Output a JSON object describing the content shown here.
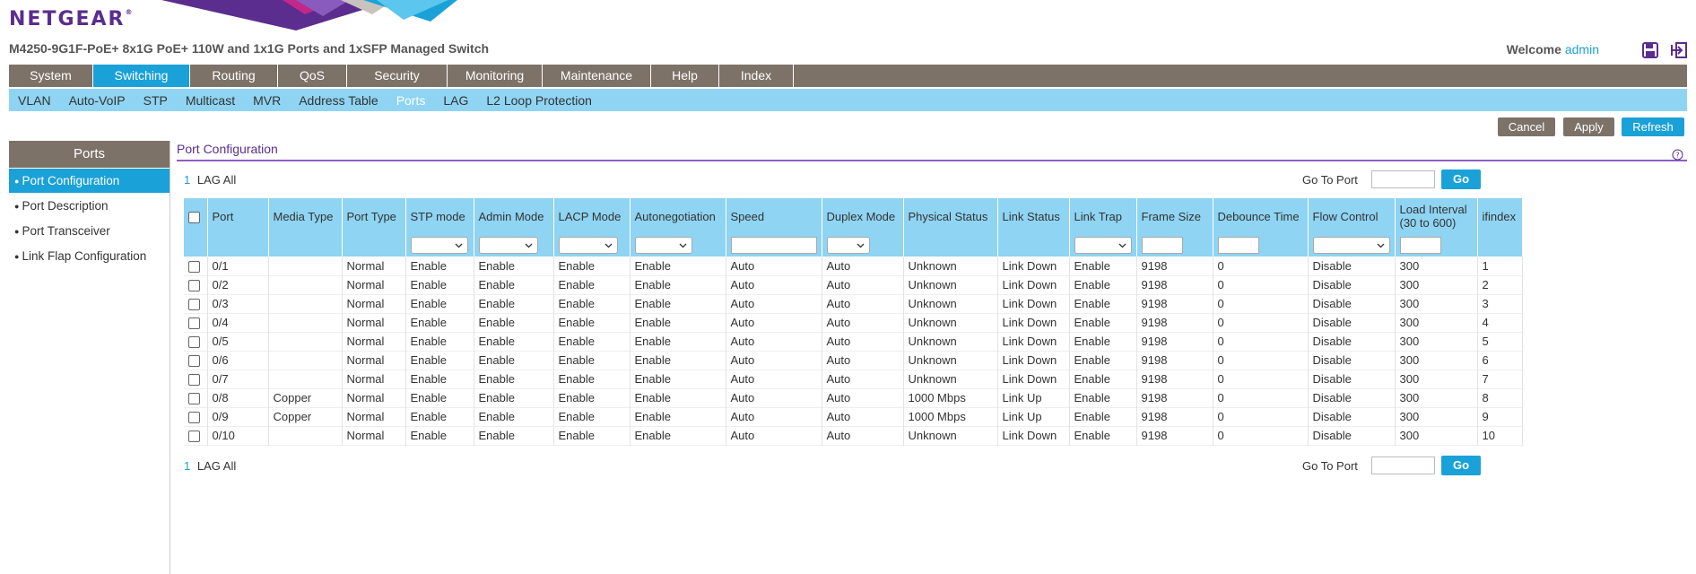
{
  "brand": {
    "logo": "NETGEAR",
    "mark": "®"
  },
  "device_title": "M4250-9G1F-PoE+ 8x1G PoE+ 110W and 1x1G Ports and 1xSFP Managed Switch",
  "welcome": {
    "label": "Welcome",
    "user": "admin"
  },
  "main_nav": [
    {
      "label": "System"
    },
    {
      "label": "Switching"
    },
    {
      "label": "Routing"
    },
    {
      "label": "QoS"
    },
    {
      "label": "Security"
    },
    {
      "label": "Monitoring"
    },
    {
      "label": "Maintenance"
    },
    {
      "label": "Help"
    },
    {
      "label": "Index"
    }
  ],
  "main_nav_active": "Switching",
  "sub_nav": [
    {
      "label": "VLAN"
    },
    {
      "label": "Auto-VoIP"
    },
    {
      "label": "STP"
    },
    {
      "label": "Multicast"
    },
    {
      "label": "MVR"
    },
    {
      "label": "Address Table"
    },
    {
      "label": "Ports"
    },
    {
      "label": "LAG"
    },
    {
      "label": "L2 Loop Protection"
    }
  ],
  "sub_nav_active": "Ports",
  "actions": {
    "cancel": "Cancel",
    "apply": "Apply",
    "refresh": "Refresh"
  },
  "sidebar": {
    "title": "Ports",
    "items": [
      {
        "label": "Port Configuration"
      },
      {
        "label": "Port Description"
      },
      {
        "label": "Port Transceiver"
      },
      {
        "label": "Link Flap Configuration"
      }
    ]
  },
  "section": {
    "title": "Port Configuration"
  },
  "pager": {
    "page": "1",
    "lag": "LAG",
    "all": "All",
    "goto_label": "Go To Port",
    "go": "Go",
    "goto_value": ""
  },
  "table": {
    "headers": [
      "Port",
      "Media Type",
      "Port Type",
      "STP mode",
      "Admin Mode",
      "LACP Mode",
      "Autonegotiation",
      "Speed",
      "Duplex Mode",
      "Physical Status",
      "Link Status",
      "Link Trap",
      "Frame Size",
      "Debounce Time",
      "Flow Control",
      "Load Interval (30 to 600)",
      "ifindex"
    ],
    "rows": [
      [
        "0/1",
        "",
        "Normal",
        "Enable",
        "Enable",
        "Enable",
        "Enable",
        "Auto",
        "Auto",
        "Unknown",
        "Link Down",
        "Enable",
        "9198",
        "0",
        "Disable",
        "300",
        "1"
      ],
      [
        "0/2",
        "",
        "Normal",
        "Enable",
        "Enable",
        "Enable",
        "Enable",
        "Auto",
        "Auto",
        "Unknown",
        "Link Down",
        "Enable",
        "9198",
        "0",
        "Disable",
        "300",
        "2"
      ],
      [
        "0/3",
        "",
        "Normal",
        "Enable",
        "Enable",
        "Enable",
        "Enable",
        "Auto",
        "Auto",
        "Unknown",
        "Link Down",
        "Enable",
        "9198",
        "0",
        "Disable",
        "300",
        "3"
      ],
      [
        "0/4",
        "",
        "Normal",
        "Enable",
        "Enable",
        "Enable",
        "Enable",
        "Auto",
        "Auto",
        "Unknown",
        "Link Down",
        "Enable",
        "9198",
        "0",
        "Disable",
        "300",
        "4"
      ],
      [
        "0/5",
        "",
        "Normal",
        "Enable",
        "Enable",
        "Enable",
        "Enable",
        "Auto",
        "Auto",
        "Unknown",
        "Link Down",
        "Enable",
        "9198",
        "0",
        "Disable",
        "300",
        "5"
      ],
      [
        "0/6",
        "",
        "Normal",
        "Enable",
        "Enable",
        "Enable",
        "Enable",
        "Auto",
        "Auto",
        "Unknown",
        "Link Down",
        "Enable",
        "9198",
        "0",
        "Disable",
        "300",
        "6"
      ],
      [
        "0/7",
        "",
        "Normal",
        "Enable",
        "Enable",
        "Enable",
        "Enable",
        "Auto",
        "Auto",
        "Unknown",
        "Link Down",
        "Enable",
        "9198",
        "0",
        "Disable",
        "300",
        "7"
      ],
      [
        "0/8",
        "Copper",
        "Normal",
        "Enable",
        "Enable",
        "Enable",
        "Enable",
        "Auto",
        "Auto",
        "1000 Mbps",
        "Link Up",
        "Enable",
        "9198",
        "0",
        "Disable",
        "300",
        "8"
      ],
      [
        "0/9",
        "Copper",
        "Normal",
        "Enable",
        "Enable",
        "Enable",
        "Enable",
        "Auto",
        "Auto",
        "1000 Mbps",
        "Link Up",
        "Enable",
        "9198",
        "0",
        "Disable",
        "300",
        "9"
      ],
      [
        "0/10",
        "",
        "Normal",
        "Enable",
        "Enable",
        "Enable",
        "Enable",
        "Auto",
        "Auto",
        "Unknown",
        "Link Down",
        "Enable",
        "9198",
        "0",
        "Disable",
        "300",
        "10"
      ]
    ]
  },
  "colors": {
    "accent": "#1aa1d8",
    "nav_bg": "#7d7268",
    "subnav_bg": "#8fd4f2",
    "brand": "#5b2d8e"
  },
  "icons": {
    "save": "save-icon",
    "logout": "logout-icon",
    "help": "help-icon"
  }
}
